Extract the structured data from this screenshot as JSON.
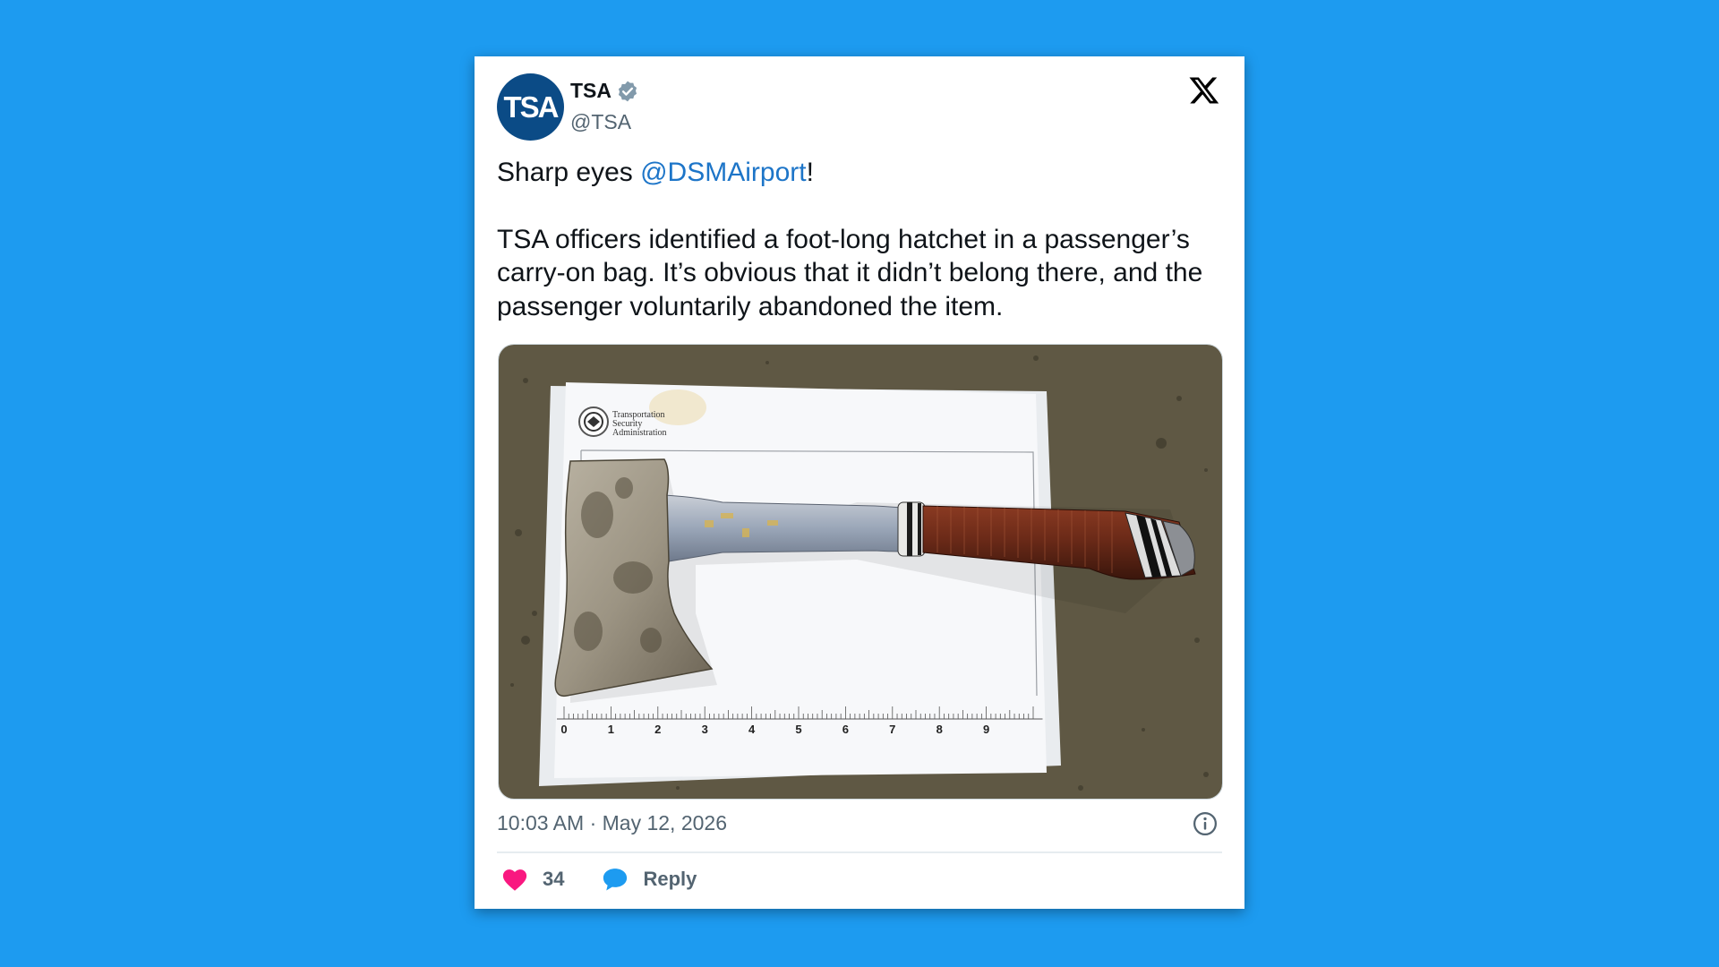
{
  "tweet": {
    "author_name": "TSA",
    "author_handle": "@TSA",
    "avatar_text": "TSA",
    "verified": true,
    "text_part1": "Sharp eyes ",
    "mention": "@DSMAirport",
    "text_part2": "!",
    "paragraph2": "TSA officers identified a foot-long hatchet in a passenger’s carry-on bag. It’s obvious that it didn’t belong there, and the passenger voluntarily abandoned the item.",
    "timestamp": "10:03 AM · May 12, 2026",
    "likes": "34",
    "reply_label": "Reply"
  },
  "media": {
    "doc_header_line1": "Transportation",
    "doc_header_line2": "Security",
    "doc_header_line3": "Administration",
    "ruler_numbers": [
      "0",
      "1",
      "2",
      "3",
      "4",
      "5",
      "6",
      "7",
      "8",
      "9"
    ]
  },
  "icons": {
    "platform": "x-logo-icon",
    "verified": "verified-badge-icon",
    "info": "info-icon",
    "like": "heart-icon",
    "reply": "speech-bubble-icon"
  },
  "colors": {
    "background": "#1d9bf0",
    "card": "#ffffff",
    "mention": "#1d75c8",
    "heart": "#f91880",
    "reply_bubble": "#1d9bf0",
    "avatar": "#0b4b86"
  }
}
